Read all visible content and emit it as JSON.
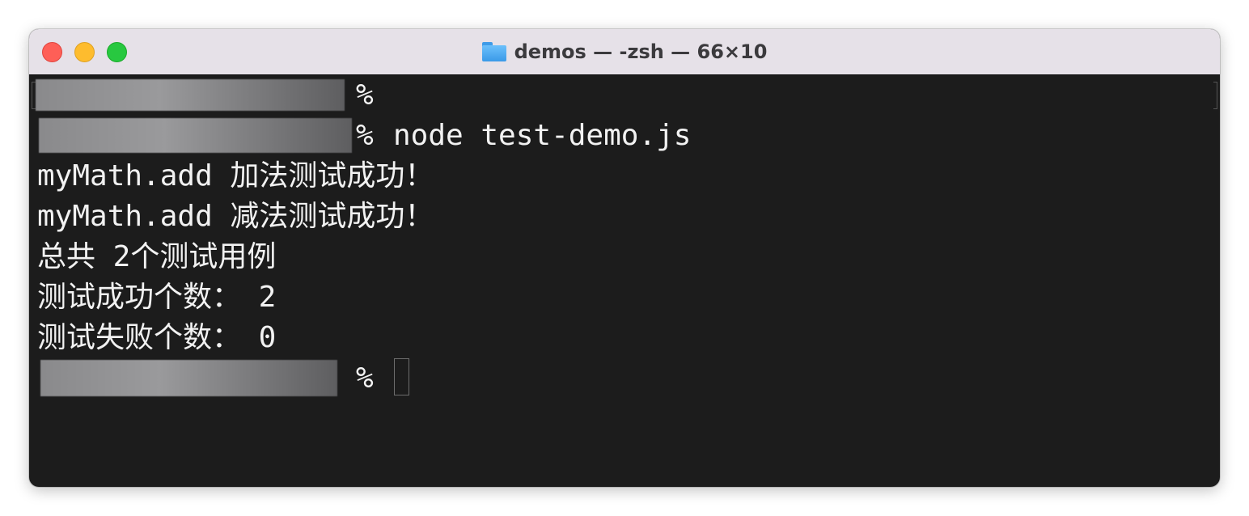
{
  "window": {
    "title": "demos — -zsh — 66×10",
    "title_icon": "folder-icon",
    "traffic_lights": {
      "close": "#fe5f57",
      "minimize": "#febc2e",
      "zoom": "#28c840"
    }
  },
  "terminal": {
    "lines": [
      {
        "prompt": "%",
        "command": ""
      },
      {
        "prompt": "%",
        "command": "node test-demo.js"
      },
      {
        "output": "myMath.add 加法测试成功！"
      },
      {
        "output": "myMath.add 减法测试成功！"
      },
      {
        "output": "总共 2个测试用例"
      },
      {
        "output": "测试成功个数： 2"
      },
      {
        "output": "测试失败个数： 0"
      },
      {
        "prompt": "%",
        "command": ""
      }
    ]
  }
}
